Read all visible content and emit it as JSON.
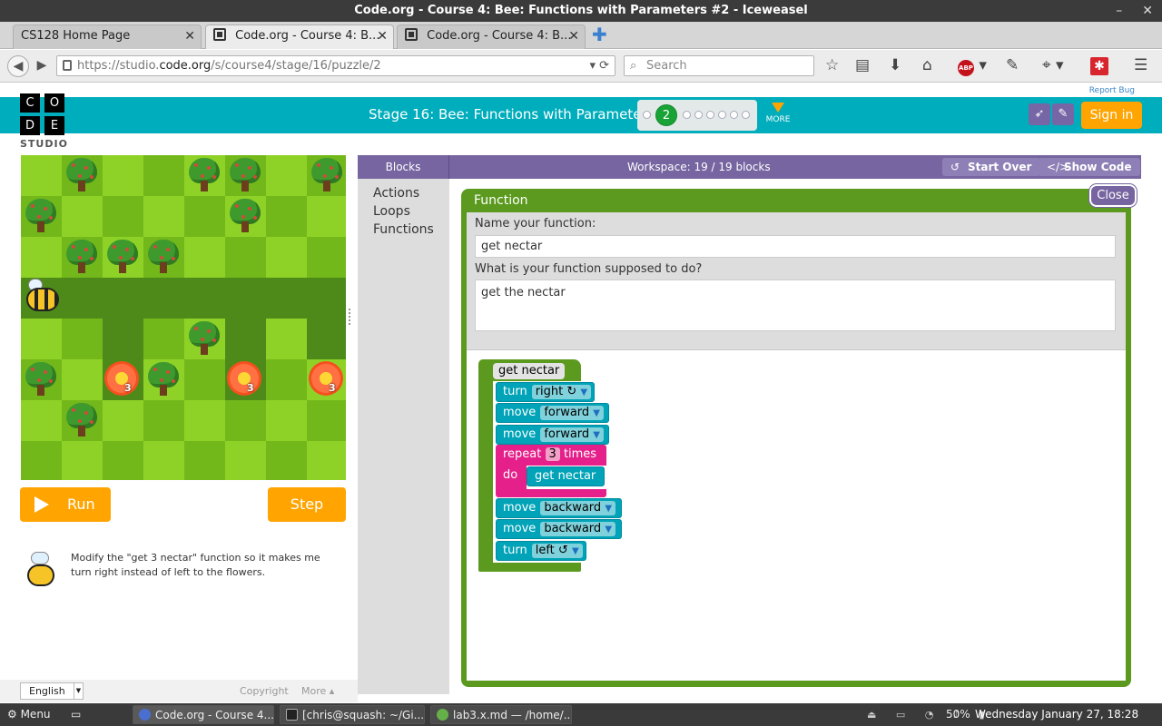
{
  "window": {
    "title": "Code.org - Course 4: Bee: Functions with Parameters #2 - Iceweasel",
    "min": "–",
    "close": "✕"
  },
  "tabs": [
    {
      "label": "CS128 Home Page"
    },
    {
      "label": "Code.org - Course 4: B..."
    },
    {
      "label": "Code.org - Course 4: B..."
    }
  ],
  "nav": {
    "url_prefix": "https://studio.",
    "url_domain": "code.org",
    "url_path": "/s/course4/stage/16/puzzle/2",
    "search_placeholder": "Search",
    "abp_label": "ABP"
  },
  "header": {
    "logo_letters": [
      "C",
      "O",
      "D",
      "E"
    ],
    "studio": "STUDIO",
    "report_bug": "Report Bug",
    "stage_title": "Stage 16: Bee: Functions with Parameters",
    "current_puzzle": "2",
    "more": "MORE",
    "sign_in": "Sign in"
  },
  "maze": {
    "flower_counts": [
      "3",
      "3",
      "3"
    ]
  },
  "controls": {
    "run": "Run",
    "step": "Step"
  },
  "instructions": "Modify the \"get 3 nectar\" function so it makes me turn right instead of left to the flowers.",
  "footer": {
    "language": "English",
    "copyright": "Copyright",
    "more": "More ▴"
  },
  "workspace": {
    "blocks_tab": "Blocks",
    "info": "Workspace: 19 / 19 blocks",
    "start_over": "Start Over",
    "show_code": "Show Code",
    "categories": [
      "Actions",
      "Loops",
      "Functions"
    ]
  },
  "function_editor": {
    "title": "Function",
    "close": "Close",
    "name_label": "Name your function:",
    "name_value": "get nectar",
    "desc_label": "What is your function supposed to do?",
    "desc_value": "get the nectar"
  },
  "blocks": {
    "def_name": "get nectar",
    "turn_right": {
      "verb": "turn",
      "value": "right ↻"
    },
    "move1": {
      "verb": "move",
      "value": "forward"
    },
    "move2": {
      "verb": "move",
      "value": "forward"
    },
    "repeat": {
      "word": "repeat",
      "count": "3",
      "times": "times",
      "do": "do"
    },
    "call": "get nectar",
    "move3": {
      "verb": "move",
      "value": "backward"
    },
    "move4": {
      "verb": "move",
      "value": "backward"
    },
    "turn_left": {
      "verb": "turn",
      "value": "left ↺"
    }
  },
  "taskbar": {
    "menu": "Menu",
    "items": [
      "Code.org - Course 4...",
      "[chris@squash: ~/Gi...",
      "lab3.x.md — /home/..."
    ],
    "battery": "50%",
    "clock": "Wednesday January 27, 18:28"
  }
}
